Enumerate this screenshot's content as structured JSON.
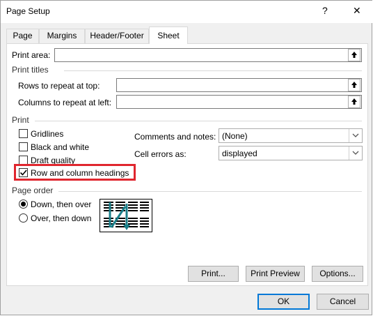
{
  "window": {
    "title": "Page Setup",
    "help": "?",
    "close": "✕"
  },
  "tabs": [
    {
      "label": "Page"
    },
    {
      "label": "Margins"
    },
    {
      "label": "Header/Footer"
    },
    {
      "label": "Sheet",
      "active": true
    }
  ],
  "print_area": {
    "label": "Print area:",
    "value": ""
  },
  "print_titles": {
    "heading": "Print titles",
    "rows_label": "Rows to repeat at top:",
    "rows_value": "",
    "cols_label": "Columns to repeat at left:",
    "cols_value": ""
  },
  "print": {
    "heading": "Print",
    "checkboxes": [
      {
        "label": "Gridlines",
        "checked": false
      },
      {
        "label": "Black and white",
        "checked": false
      },
      {
        "label": "Draft quality",
        "checked": false
      },
      {
        "label": "Row and column headings",
        "checked": true
      }
    ],
    "comments_label": "Comments and notes:",
    "comments_value": "(None)",
    "errors_label": "Cell errors as:",
    "errors_value": "displayed"
  },
  "page_order": {
    "heading": "Page order",
    "options": [
      {
        "label": "Down, then over",
        "selected": true
      },
      {
        "label": "Over, then down",
        "selected": false
      }
    ]
  },
  "buttons": {
    "print": "Print...",
    "preview": "Print Preview",
    "options": "Options...",
    "ok": "OK",
    "cancel": "Cancel"
  },
  "colors": {
    "highlight": "#e0262e",
    "accent": "#0078d7",
    "order_arrow": "#1a7f8a"
  }
}
